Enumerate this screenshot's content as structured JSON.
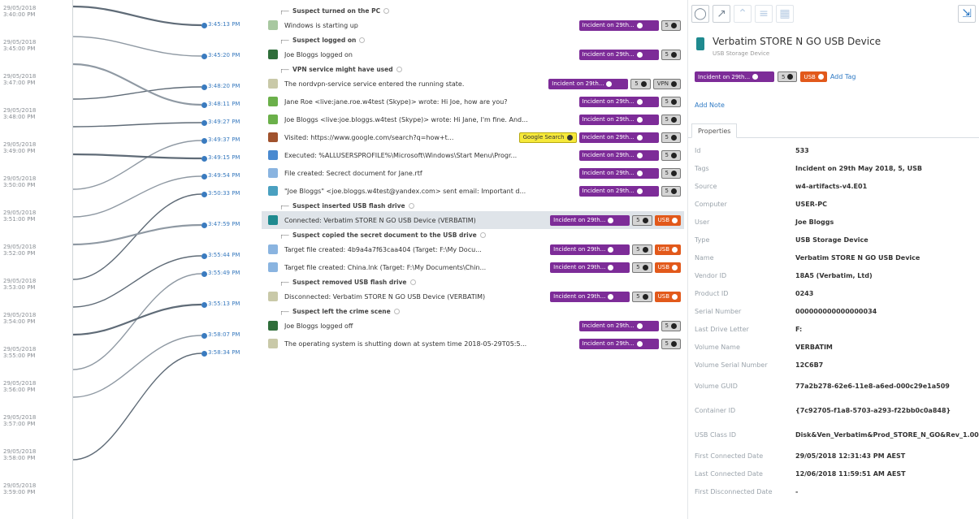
{
  "axis_labels": [
    {
      "date": "29/05/2018",
      "time": "3:40:00 PM"
    },
    {
      "date": "29/05/2018",
      "time": "3:45:00 PM"
    },
    {
      "date": "29/05/2018",
      "time": "3:47:00 PM"
    },
    {
      "date": "29/05/2018",
      "time": "3:48:00 PM"
    },
    {
      "date": "29/05/2018",
      "time": "3:49:00 PM"
    },
    {
      "date": "29/05/2018",
      "time": "3:50:00 PM"
    },
    {
      "date": "29/05/2018",
      "time": "3:51:00 PM"
    },
    {
      "date": "29/05/2018",
      "time": "3:52:00 PM"
    },
    {
      "date": "29/05/2018",
      "time": "3:53:00 PM"
    },
    {
      "date": "29/05/2018",
      "time": "3:54:00 PM"
    },
    {
      "date": "29/05/2018",
      "time": "3:55:00 PM"
    },
    {
      "date": "29/05/2018",
      "time": "3:56:00 PM"
    },
    {
      "date": "29/05/2018",
      "time": "3:57:00 PM"
    },
    {
      "date": "29/05/2018",
      "time": "3:58:00 PM"
    },
    {
      "date": "29/05/2018",
      "time": "3:59:00 PM"
    }
  ],
  "tag_labels": {
    "incident": "Incident on 29th...",
    "num": "5",
    "vpn": "VPN",
    "usb": "USB",
    "google": "Google Search"
  },
  "timeline": {
    "groups": [
      {
        "title": "Suspect turned on the PC",
        "events": [
          {
            "time": "3:45:13 PM",
            "text": "Windows is starting up",
            "icon_color": "#a8c8a0",
            "tags": [
              "incident",
              "num"
            ]
          }
        ]
      },
      {
        "title": "Suspect logged on",
        "events": [
          {
            "time": "3:45:20 PM",
            "text": "Joe Bloggs logged on",
            "icon_color": "#2f6e3a",
            "tags": [
              "incident",
              "num"
            ]
          }
        ]
      },
      {
        "title": "VPN service might have used",
        "events": [
          {
            "time": "3:48:20 PM",
            "text": "The nordvpn-service service entered the running state.",
            "icon_color": "#c9c9a8",
            "tags": [
              "incident",
              "num",
              "vpn"
            ]
          },
          {
            "time": "3:48:11 PM",
            "text": "Jane Roe <live:jane.roe.w4test (Skype)> wrote: Hi Joe, how are you?",
            "icon_color": "#6bb04a",
            "tags": [
              "incident",
              "num"
            ]
          },
          {
            "time": "3:49:27 PM",
            "text": "Joe Bloggs <live:joe.bloggs.w4test (Skype)> wrote: Hi Jane, I'm fine. And...",
            "icon_color": "#6bb04a",
            "tags": [
              "incident",
              "num"
            ]
          },
          {
            "time": "3:49:37 PM",
            "text": "Visited: https://www.google.com/search?q=how+t...",
            "icon_color": "#a0522d",
            "tags": [
              "google",
              "incident",
              "num"
            ]
          },
          {
            "time": "3:49:15 PM",
            "text": "Executed: %ALLUSERSPROFILE%\\Microsoft\\Windows\\Start Menu\\Progr...",
            "icon_color": "#4a8ad0",
            "tags": [
              "incident",
              "num"
            ]
          },
          {
            "time": "3:49:54 PM",
            "text": "File created: Secrect document for Jane.rtf",
            "icon_color": "#8ab4e0",
            "tags": [
              "incident",
              "num"
            ]
          },
          {
            "time": "3:50:33 PM",
            "text": "\"Joe Bloggs\" <joe.bloggs.w4test@yandex.com> sent email: Important d...",
            "icon_color": "#4aa0c0",
            "tags": [
              "incident",
              "num"
            ]
          }
        ]
      },
      {
        "title": "Suspect inserted USB flash drive",
        "events": [
          {
            "time": "3:47:59 PM",
            "text": "Connected: Verbatim STORE N GO USB Device (VERBATIM)",
            "icon_color": "#1f8a8f",
            "tags": [
              "incident",
              "num",
              "usb"
            ],
            "selected": true
          }
        ]
      },
      {
        "title": "Suspect copied the secret document to the USB drive",
        "events": [
          {
            "time": "3:55:44 PM",
            "text": "Target file created: 4b9a4a7f63caa404 (Target: F:\\My Docu...",
            "icon_color": "#8ab4e0",
            "tags": [
              "incident",
              "num",
              "usb"
            ]
          },
          {
            "time": "3:55:49 PM",
            "text": "Target file created: China.lnk (Target: F:\\My Documents\\Chin...",
            "icon_color": "#8ab4e0",
            "tags": [
              "incident",
              "num",
              "usb"
            ]
          }
        ]
      },
      {
        "title": "Suspect removed USB flash drive",
        "events": [
          {
            "time": "3:55:13 PM",
            "text": "Disconnected: Verbatim STORE N GO USB Device (VERBATIM)",
            "icon_color": "#c9c9a8",
            "tags": [
              "incident",
              "num",
              "usb"
            ]
          }
        ]
      },
      {
        "title": "Suspect left the crime scene",
        "events": [
          {
            "time": "3:58:07 PM",
            "text": "Joe Bloggs logged off",
            "icon_color": "#2f6e3a",
            "tags": [
              "incident",
              "num"
            ]
          },
          {
            "time": "3:58:34 PM",
            "text": "The operating system is shutting down at system time 2018-05-29T05:5...",
            "icon_color": "#c9c9a8",
            "tags": [
              "incident",
              "num"
            ]
          }
        ]
      }
    ]
  },
  "panel": {
    "device_name": "Verbatim STORE N GO USB Device",
    "device_type": "USB Storage Device",
    "add_tag": "Add Tag",
    "add_note": "Add Note",
    "tab_properties": "Properties",
    "properties": [
      {
        "key": "Id",
        "value": "533"
      },
      {
        "key": "Tags",
        "value": "Incident on 29th May 2018, 5, USB"
      },
      {
        "key": "Source",
        "value": "w4-artifacts-v4.E01"
      },
      {
        "key": "Computer",
        "value": "USER-PC"
      },
      {
        "key": "User",
        "value": "Joe Bloggs"
      },
      {
        "key": "Type",
        "value": "USB Storage Device"
      },
      {
        "key": "Name",
        "value": "Verbatim STORE N GO USB Device"
      },
      {
        "key": "Vendor ID",
        "value": "18A5 (Verbatim, Ltd)"
      },
      {
        "key": "Product ID",
        "value": "0243"
      },
      {
        "key": "Serial Number",
        "value": "000000000000000034"
      },
      {
        "key": "Last Drive Letter",
        "value": "F:"
      },
      {
        "key": "Volume Name",
        "value": "VERBATIM"
      },
      {
        "key": "Volume Serial Number",
        "value": "12C6B7"
      },
      {
        "key": "Volume GUID",
        "value": "77a2b278-62e6-11e8-a6ed-000c29e1a509"
      },
      {
        "key": "Container ID",
        "value": "{7c92705-f1a8-5703-a293-f22bb0c0a848}"
      },
      {
        "key": "USB Class ID",
        "value": "Disk&Ven_Verbatim&Prod_STORE_N_GO&Rev_1.00"
      },
      {
        "key": "First Connected Date",
        "value": "29/05/2018 12:31:43 PM AEST"
      },
      {
        "key": "Last Connected Date",
        "value": "12/06/2018 11:59:51 AM AEST"
      },
      {
        "key": "First Disconnected Date",
        "value": "-"
      }
    ]
  },
  "colors": {
    "incident": "#7d2c98",
    "usb": "#e2591b",
    "google": "#f6e93a",
    "link": "#2d79c4",
    "selected_row": "#dfe4e9"
  }
}
